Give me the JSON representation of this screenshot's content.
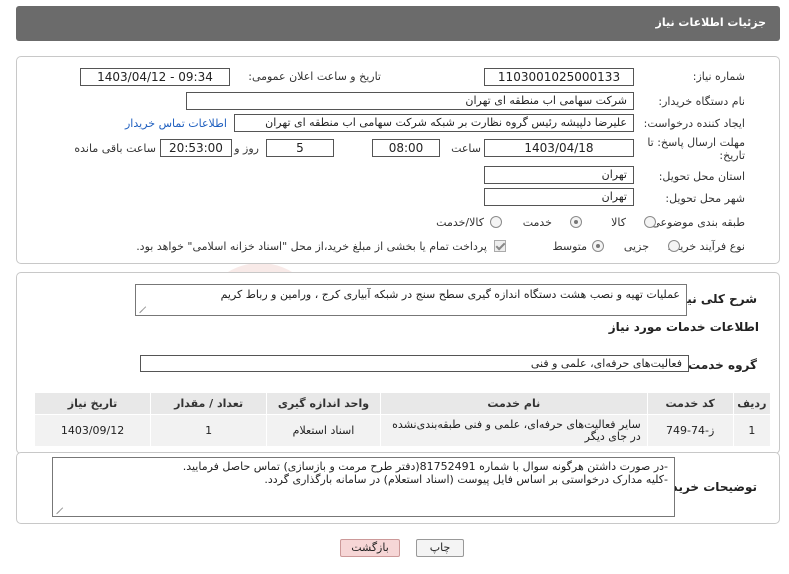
{
  "header": {
    "title": "جزئیات اطلاعات نیاز"
  },
  "form": {
    "need_number_label": "شماره نیاز:",
    "need_number": "1103001025000133",
    "announce_label": "تاریخ و ساعت اعلان عمومی:",
    "announce_value": "1403/04/12 - 09:34",
    "buyer_org_label": "نام دستگاه خریدار:",
    "buyer_org": "شرکت سهامی اب منطقه ای تهران",
    "creator_label": "ایجاد کننده درخواست:",
    "creator": "علیرضا دلپیشه رئیس گروه نظارت بر شبکه شرکت سهامی اب منطقه ای تهران",
    "contact_link": "اطلاعات تماس خریدار",
    "deadline_label": "مهلت ارسال پاسخ: تا تاریخ:",
    "deadline_date": "1403/04/18",
    "time_label": "ساعت",
    "deadline_time": "08:00",
    "days_value": "5",
    "days_label": "روز و",
    "remaining_time": "20:53:00",
    "remaining_label": "ساعت باقی مانده",
    "province_label": "استان محل تحویل:",
    "province": "تهران",
    "city_label": "شهر محل تحویل:",
    "city": "تهران",
    "category_label": "طبقه بندی موضوعی:",
    "category_options": [
      "کالا",
      "خدمت",
      "کالا/خدمت"
    ],
    "category_selected": "خدمت",
    "process_label": "نوع فرآیند خرید :",
    "process_options": [
      "جزیی",
      "متوسط"
    ],
    "process_selected": "متوسط",
    "payment_note": "پرداخت تمام یا بخشی از مبلغ خرید،از محل \"اسناد خزانه اسلامی\" خواهد بود."
  },
  "summary": {
    "label": "شرح کلی نیاز:",
    "text": "عملیات تهیه و نصب هشت دستگاه اندازه گیری سطح سنج در شبکه آبیاری کرج ، ورامین و رباط کریم"
  },
  "services": {
    "section_title": "اطلاعات خدمات مورد نیاز",
    "group_label": "گروه خدمت:",
    "group_value": "فعالیت‌های حرفه‌ای، علمی و فنی",
    "columns": [
      "ردیف",
      "کد خدمت",
      "نام خدمت",
      "واحد اندازه گیری",
      "تعداد / مقدار",
      "تاریخ نیاز"
    ],
    "rows": [
      [
        "1",
        "ز-74-749",
        "سایر فعالیت‌های حرفه‌ای، علمی و فنی طبقه‌بندی‌نشده در جای دیگر",
        "اسناد استعلام",
        "1",
        "1403/09/12"
      ]
    ]
  },
  "buyer_notes": {
    "label": "توضیحات خریدار:",
    "line1": "-در صورت داشتن هرگونه سوال با شماره 81752491(دفتر طرح مرمت و بازسازی) تماس حاصل فرمایید.",
    "line2": "-کلیه مدارک درخواستی بر اساس فایل پیوست (اسناد استعلام) در سامانه بارگذاری گردد."
  },
  "buttons": {
    "print": "چاپ",
    "back": "بازگشت"
  },
  "watermark": {
    "text": "AriaTender.neT"
  },
  "colors": {
    "header_bg": "#6b6b6b",
    "link": "#1f5fbf",
    "back_btn_bg": "#f6d6d6"
  }
}
